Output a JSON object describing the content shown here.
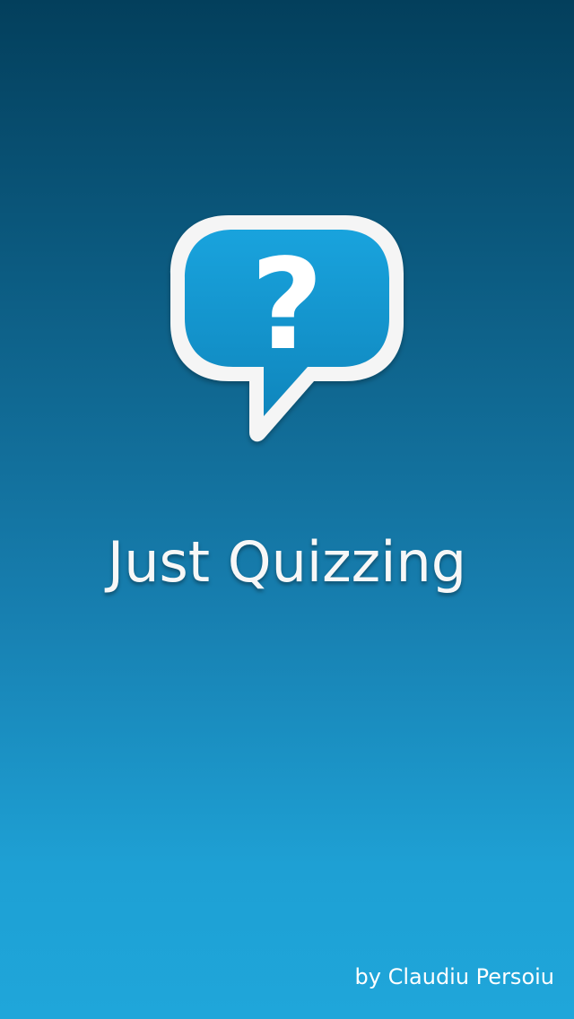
{
  "app": {
    "title": "Just Quizzing",
    "author": "by Claudiu Persoiu"
  },
  "logo": {
    "icon": "question-bubble-icon",
    "glyph": "?",
    "bubble_color": "#1295cf",
    "border_color": "#f5f5f5"
  },
  "colors": {
    "background_top": "#033f5c",
    "background_bottom": "#1fa6da",
    "text": "#f7f7f7"
  }
}
